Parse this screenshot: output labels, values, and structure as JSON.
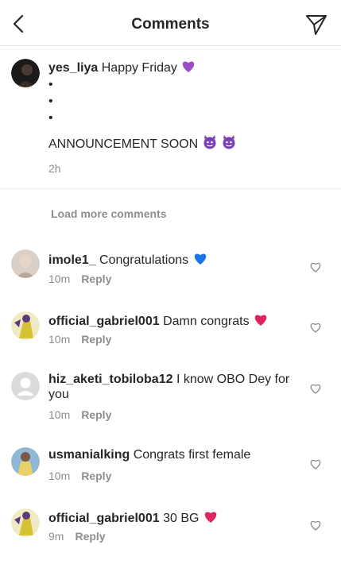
{
  "header": {
    "title": "Comments"
  },
  "caption": {
    "username": "yes_liya",
    "text": "Happy Friday",
    "bullets": [
      "•",
      "•",
      "•"
    ],
    "announcement": "ANNOUNCEMENT SOON",
    "time": "2h"
  },
  "load_more": "Load more comments",
  "comments": [
    {
      "username": "imole1_",
      "text": "Congratulations",
      "time": "10m",
      "reply": "Reply"
    },
    {
      "username": "official_gabriel001",
      "text": "Damn congrats",
      "time": "10m",
      "reply": "Reply"
    },
    {
      "username": "hiz_aketi_tobiloba12",
      "text": "I know OBO Dey for you",
      "time": "10m",
      "reply": "Reply"
    },
    {
      "username": "usmanialking",
      "text": "Congrats first female",
      "time": "10m",
      "reply": "Reply"
    },
    {
      "username": "official_gabriel001",
      "text": "30 BG",
      "time": "9m",
      "reply": "Reply"
    }
  ],
  "colors": {
    "heart_red": "#e0245e",
    "purple_heart": "#9b4dca",
    "blue_heart": "#1a73e8",
    "muted": "#8e8e8e"
  }
}
